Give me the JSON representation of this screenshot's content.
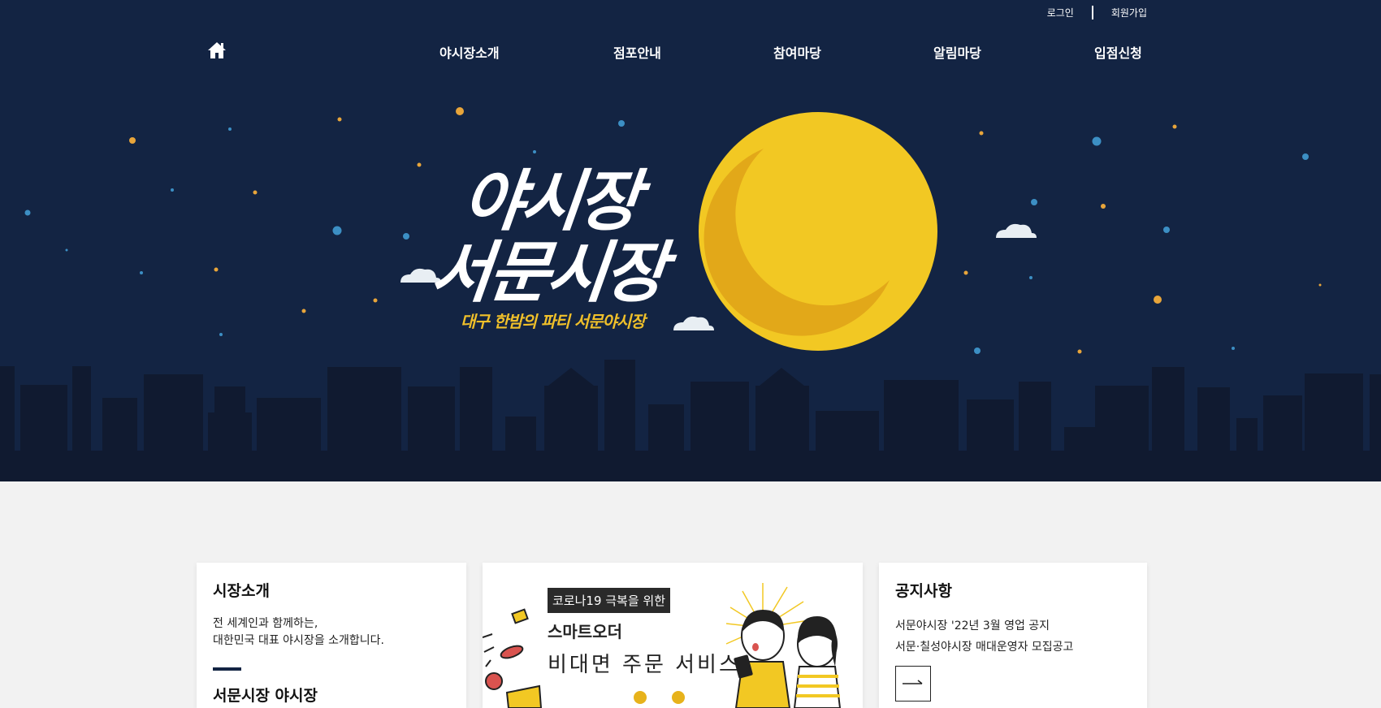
{
  "header": {
    "login": "로그인",
    "signup": "회원가입"
  },
  "nav": {
    "home_icon": "home-icon",
    "items": [
      "야시장소개",
      "점포안내",
      "참여마당",
      "알림마당",
      "입점신청"
    ]
  },
  "hero": {
    "title_line1": "야시장",
    "title_line2": "서문시장",
    "subtitle": "대구 한밤의 파티 서문야시장",
    "colors": {
      "sky": "#132443",
      "moon": "#f2c823",
      "skyline": "#101a30",
      "accent": "#f0c02a"
    }
  },
  "intro": {
    "title": "시장소개",
    "line1": "전 세계인과 함께하는,",
    "line2": "대한민국 대표 야시장을 소개합니다.",
    "subtitle": "서문시장 야시장"
  },
  "promo": {
    "tag": "코로나19 극복을 위한",
    "title": "스마트오더",
    "subtitle": "비대면 주문 서비스"
  },
  "notice": {
    "title": "공지사항",
    "items": [
      "서문야시장 '22년 3월 영업 공지",
      "서문·칠성야시장 매대운영자 모집공고"
    ],
    "more_icon": "arrow-right-icon"
  }
}
